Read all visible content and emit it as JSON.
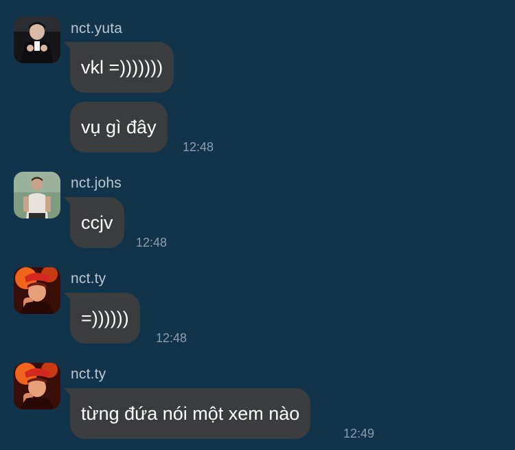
{
  "colors": {
    "background": "#12344a",
    "bubble": "#3b3c3e",
    "sender_name": "#b9c7d3",
    "timestamp": "#8c9eac",
    "message_text": "#ffffff"
  },
  "messages": [
    {
      "sender": "nct.yuta",
      "avatar_icon": "user-avatar-icon",
      "bubbles": [
        {
          "text": "vkl =)))))))",
          "time": ""
        },
        {
          "text": "vụ gì đây",
          "time": "12:48"
        }
      ]
    },
    {
      "sender": "nct.johs",
      "avatar_icon": "user-avatar-icon",
      "bubbles": [
        {
          "text": "ccjv",
          "time": "12:48"
        }
      ]
    },
    {
      "sender": "nct.ty",
      "avatar_icon": "user-avatar-icon",
      "bubbles": [
        {
          "text": "=))))))",
          "time": "12:48"
        }
      ]
    },
    {
      "sender": "nct.ty",
      "avatar_icon": "user-avatar-icon",
      "bubbles": [
        {
          "text": "từng đứa nói một xem nào",
          "time": "12:49"
        }
      ]
    }
  ]
}
